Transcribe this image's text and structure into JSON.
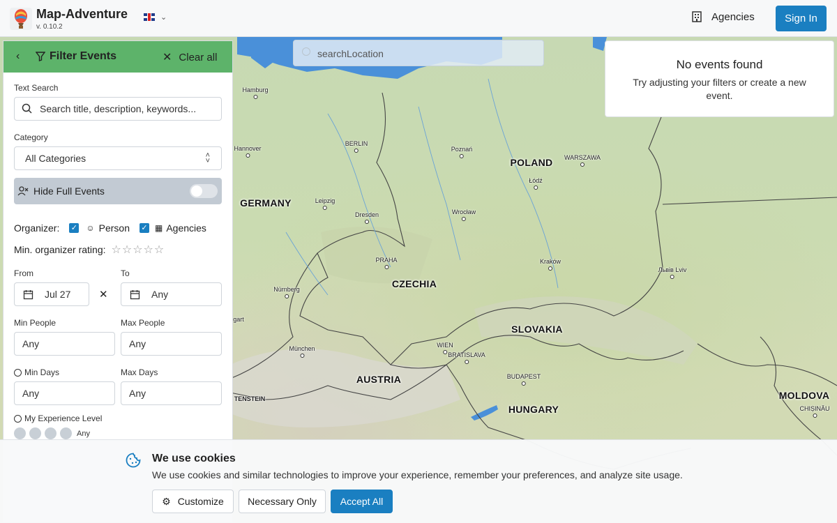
{
  "header": {
    "app_name": "Map-Adventure",
    "version": "v. 0.10.2",
    "agencies_label": "Agencies",
    "signin_label": "Sign In"
  },
  "map": {
    "search_placeholder": "searchLocation",
    "countries": [
      "GERMANY",
      "POLAND",
      "CZECHIA",
      "SLOVAKIA",
      "AUSTRIA",
      "HUNGARY",
      "MOLDOVA"
    ],
    "cities": [
      "Hamburg",
      "Hannover",
      "BERLIN",
      "Leipzig",
      "Dresden",
      "Poznań",
      "WARSZAWA",
      "Łódź",
      "Wrocław",
      "PRAHA",
      "Kraków",
      "Львів Lviv",
      "Nürnberg",
      "München",
      "WIEN",
      "BRATISLAVA",
      "BUDAPEST",
      "CHIȘINĂU"
    ],
    "edge_labels": [
      "gart",
      "TENSTEIN"
    ]
  },
  "no_events": {
    "title": "No events found",
    "subtitle": "Try adjusting your filters or create a new event."
  },
  "filter": {
    "title": "Filter Events",
    "clear_label": "Clear all",
    "text_search_label": "Text Search",
    "text_search_placeholder": "Search title, description, keywords...",
    "category_label": "Category",
    "category_value": "All Categories",
    "hide_full_label": "Hide Full Events",
    "hide_full_on": false,
    "organizer_label": "Organizer:",
    "organizer_person": "Person",
    "organizer_agencies": "Agencies",
    "min_rating_label": "Min. organizer rating:",
    "min_rating_value": 0,
    "from_label": "From",
    "from_value": "Jul 27",
    "to_label": "To",
    "to_value": "Any",
    "min_people_label": "Min People",
    "min_people_value": "Any",
    "max_people_label": "Max People",
    "max_people_value": "Any",
    "min_days_label": "Min Days",
    "min_days_value": "Any",
    "max_days_label": "Max Days",
    "max_days_value": "Any",
    "experience_label": "My Experience Level",
    "experience_value": "Any"
  },
  "cookie": {
    "title": "We use cookies",
    "text": "We use cookies and similar technologies to improve your experience, remember your preferences, and analyze site usage.",
    "customize_label": "Customize",
    "necessary_label": "Necessary Only",
    "accept_label": "Accept All"
  },
  "colors": {
    "accent": "#1a7fc1",
    "panel_header": "#5db36a",
    "water": "#4a90d9"
  }
}
